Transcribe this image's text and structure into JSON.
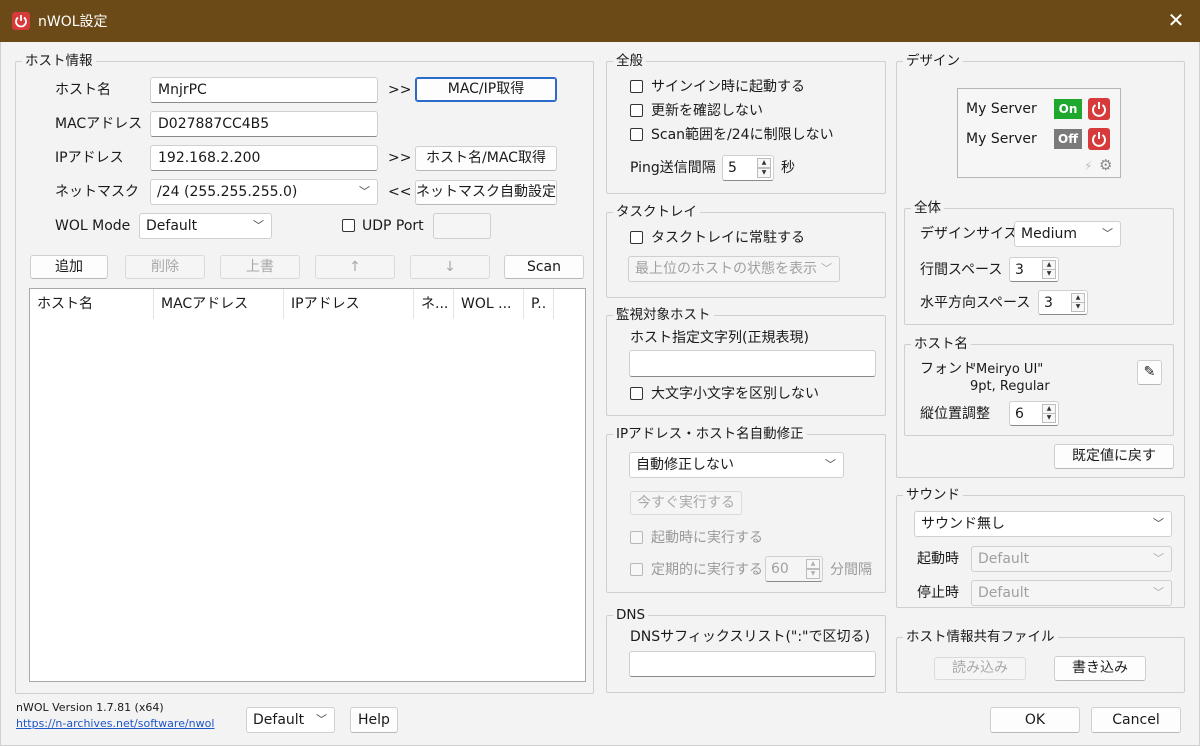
{
  "window": {
    "title": "nWOL設定",
    "close": "✕"
  },
  "host_info": {
    "title": "ホスト情報",
    "hostname_label": "ホスト名",
    "hostname_value": "MnjrPC",
    "mac_label": "MACアドレス",
    "mac_value": "D027887CC4B5",
    "ip_label": "IPアドレス",
    "ip_value": "192.168.2.200",
    "netmask_label": "ネットマスク",
    "netmask_value": "/24 (255.255.255.0)",
    "wol_mode_label": "WOL Mode",
    "wol_mode_value": "Default",
    "udp_port_label": "UDP Port",
    "udp_port_value": "",
    "arrow_right_1": ">>",
    "arrow_right_2": ">>",
    "arrow_left": "<<",
    "get_macip_button": "MAC/IP取得",
    "get_hostmac_button": "ホスト名/MAC取得",
    "auto_netmask_button": "ネットマスク自動設定",
    "add_button": "追加",
    "delete_button": "削除",
    "overwrite_button": "上書",
    "up_button": "↑",
    "down_button": "↓",
    "scan_button": "Scan",
    "columns": [
      "ホスト名",
      "MACアドレス",
      "IPアドレス",
      "ネ...",
      "WOL ...",
      "P.."
    ]
  },
  "general": {
    "title": "全般",
    "signin_start": "サインイン時に起動する",
    "no_update_check": "更新を確認しない",
    "limit_scan": "Scan範囲を/24に制限しない",
    "ping_interval_label": "Ping送信間隔",
    "ping_interval_value": "5",
    "ping_interval_unit": "秒"
  },
  "tasktray": {
    "title": "タスクトレイ",
    "resident": "タスクトレイに常駐する",
    "display_option": "最上位のホストの状態を表示"
  },
  "monitor": {
    "title": "監視対象ホスト",
    "pattern_label": "ホスト指定文字列(正規表現)",
    "pattern_value": "",
    "case_insensitive": "大文字小文字を区別しない"
  },
  "auto_fix": {
    "title": "IPアドレス・ホスト名自動修正",
    "mode_value": "自動修正しない",
    "run_now_button": "今すぐ実行する",
    "on_start": "起動時に実行する",
    "periodic": "定期的に実行する",
    "interval_value": "60",
    "interval_unit": "分間隔"
  },
  "dns": {
    "title": "DNS",
    "suffix_label": "DNSサフィックスリスト(\":\"で区切る)",
    "suffix_value": ""
  },
  "design": {
    "title": "デザイン",
    "preview": {
      "server1": "My Server",
      "status1": "On",
      "server2": "My Server",
      "status2": "Off"
    },
    "overall_title": "全体",
    "design_size_label": "デザインサイズ",
    "design_size_value": "Medium",
    "line_spacing_label": "行間スペース",
    "line_spacing_value": "3",
    "horizontal_spacing_label": "水平方向スペース",
    "horizontal_spacing_value": "3",
    "hostname_title": "ホスト名",
    "font_label": "フォント",
    "font_value": "\"Meiryo UI\"",
    "font_detail": "9pt, Regular",
    "vertical_adjust_label": "縦位置調整",
    "vertical_adjust_value": "6",
    "reset_button": "既定値に戻す",
    "on_color": "#1fa82e",
    "off_color": "#7a7a7a",
    "power_color": "#d63a3a"
  },
  "sound": {
    "title": "サウンド",
    "mode_value": "サウンド無し",
    "start_label": "起動時",
    "start_value": "Default",
    "stop_label": "停止時",
    "stop_value": "Default"
  },
  "share": {
    "title": "ホスト情報共有ファイル",
    "read_button": "読み込み",
    "write_button": "書き込み"
  },
  "footer": {
    "version": "nWOL Version 1.7.81 (x64)",
    "url": "https://n-archives.net/software/nwol",
    "profile_value": "Default",
    "help_button": "Help",
    "ok_button": "OK",
    "cancel_button": "Cancel"
  }
}
